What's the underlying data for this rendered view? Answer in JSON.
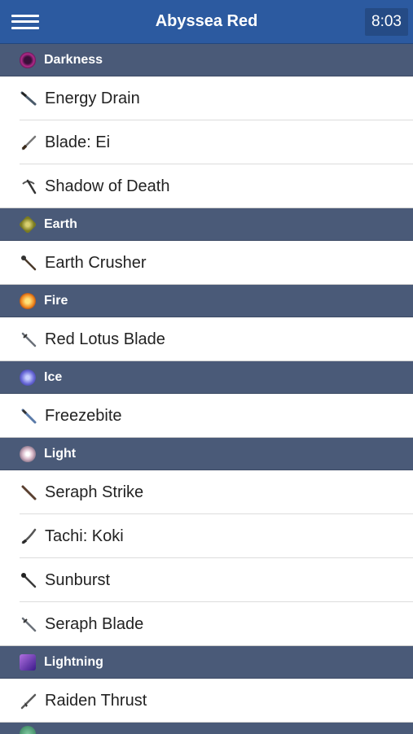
{
  "header": {
    "title": "Abyssea Red",
    "time": "8:03"
  },
  "sections": [
    {
      "name": "Darkness",
      "icon": "darkness-orb-icon",
      "items": [
        {
          "label": "Energy Drain",
          "icon": "dagger-icon"
        },
        {
          "label": "Blade: Ei",
          "icon": "katana-icon"
        },
        {
          "label": "Shadow of Death",
          "icon": "scythe-icon"
        }
      ]
    },
    {
      "name": "Earth",
      "icon": "earth-gem-icon",
      "items": [
        {
          "label": "Earth Crusher",
          "icon": "staff-icon"
        }
      ]
    },
    {
      "name": "Fire",
      "icon": "fire-orb-icon",
      "items": [
        {
          "label": "Red Lotus Blade",
          "icon": "sword-icon"
        }
      ]
    },
    {
      "name": "Ice",
      "icon": "ice-orb-icon",
      "items": [
        {
          "label": "Freezebite",
          "icon": "greatsword-icon"
        }
      ]
    },
    {
      "name": "Light",
      "icon": "light-orb-icon",
      "items": [
        {
          "label": "Seraph Strike",
          "icon": "club-icon"
        },
        {
          "label": "Tachi: Koki",
          "icon": "great-katana-icon"
        },
        {
          "label": "Sunburst",
          "icon": "staff-icon"
        },
        {
          "label": "Seraph Blade",
          "icon": "sword-icon"
        }
      ]
    },
    {
      "name": "Lightning",
      "icon": "lightning-icon",
      "items": [
        {
          "label": "Raiden Thrust",
          "icon": "polearm-icon"
        }
      ]
    }
  ]
}
